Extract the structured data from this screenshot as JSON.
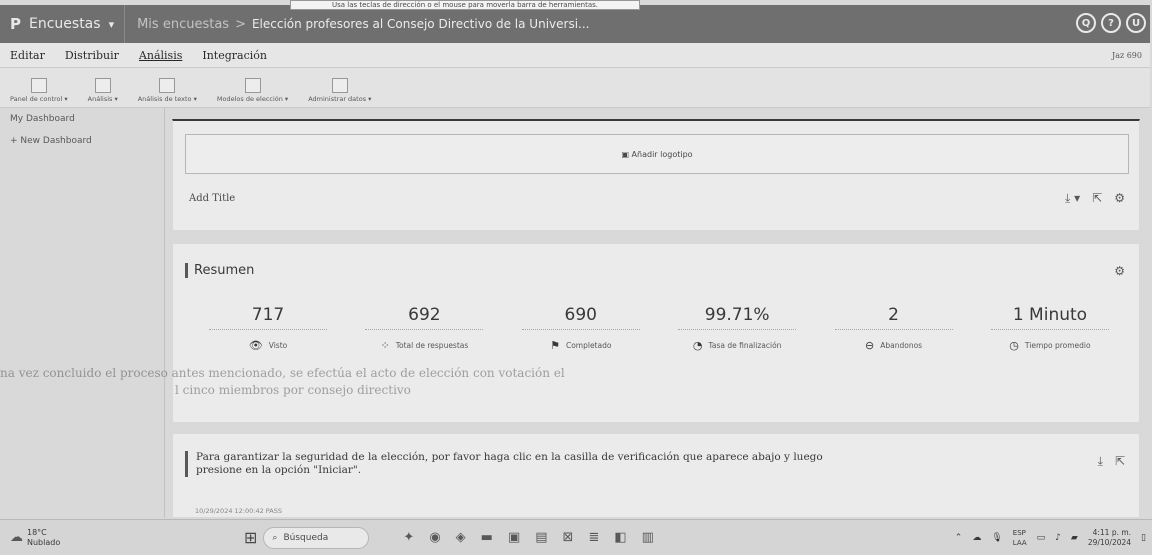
{
  "tooltip": "Usa las teclas de dirección o el mouse para moverla barra de herramientas.",
  "topbar": {
    "logo": "P",
    "brand": "Encuestas",
    "caret": "▾",
    "crumb": "Mis encuestas",
    "crumb_sep": ">",
    "survey_title": "Elección profesores al Consejo Directivo de la Universi...",
    "icons": [
      "search-icon",
      "help-icon",
      "user-icon"
    ],
    "icon_glyphs": [
      "Q",
      "?",
      "U"
    ]
  },
  "menubar": {
    "items": [
      "Editar",
      "Distribuir",
      "Análisis",
      "Integración"
    ],
    "active": "Análisis",
    "right_text": "Jaz 690"
  },
  "toolbar": {
    "items": [
      "Panel de control ▾",
      "Análisis ▾",
      "Análisis de texto ▾",
      "Modelos de elección ▾",
      "Administrar datos ▾"
    ]
  },
  "sidebar": {
    "items": [
      "My Dashboard",
      "+ New Dashboard"
    ]
  },
  "card1": {
    "logo_button": "▣ Añadir logotipo",
    "add_title": "Add Title",
    "actions": [
      "⤓ ▾",
      "⇱",
      "⚙"
    ]
  },
  "summary": {
    "title": "Resumen",
    "gear": "⚙",
    "stats": [
      {
        "value": "717",
        "label": "Visto",
        "icon": "eye-icon",
        "glyph": "👁"
      },
      {
        "value": "692",
        "label": "Total de respuestas",
        "icon": "responses-icon",
        "glyph": "⁘"
      },
      {
        "value": "690",
        "label": "Completado",
        "icon": "flag-icon",
        "glyph": "⚑"
      },
      {
        "value": "99.71%",
        "label": "Tasa de finalización",
        "icon": "completion-rate-icon",
        "glyph": "◔"
      },
      {
        "value": "2",
        "label": "Abandonos",
        "icon": "abandon-icon",
        "glyph": "⊖"
      },
      {
        "value": "1 Minuto",
        "label": "Tiempo promedio",
        "icon": "clock-icon",
        "glyph": "◷"
      }
    ]
  },
  "notice": {
    "text": "Para garantizar la seguridad de la elección, por favor haga clic en la casilla de verificación que aparece abajo y luego presione en la opción \"Iniciar\".",
    "meta": "10/29/2024   12:00:42   PASS",
    "actions": [
      "⤓",
      "⇱"
    ]
  },
  "watermark": {
    "line1": "na vez concluido el proceso antes mencionado, se efectúa el acto de elección con votación el",
    "line2": "l cinco miembros por consejo directivo"
  },
  "taskbar": {
    "temp": "18°C",
    "weather": "Nublado",
    "search": "Búsqueda",
    "lang_top": "ESP",
    "lang_bottom": "LAA",
    "time": "4:11 p. m.",
    "date": "29/10/2024"
  }
}
